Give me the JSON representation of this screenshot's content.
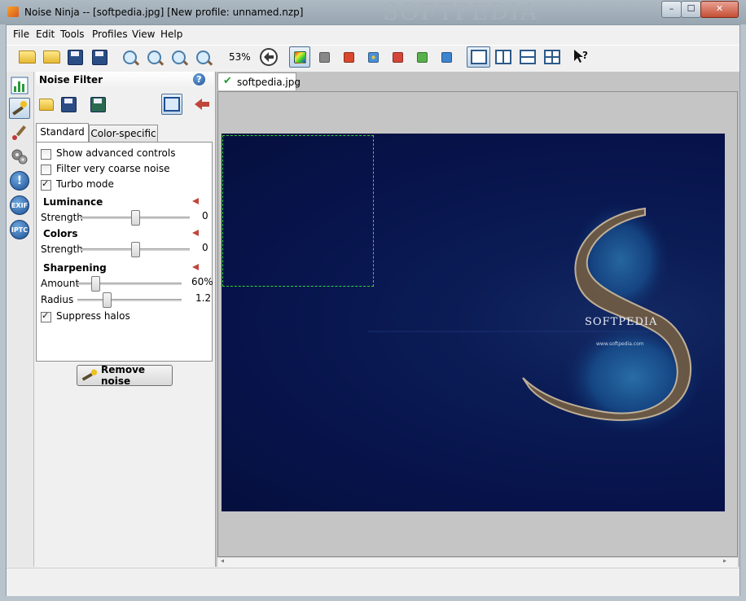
{
  "window": {
    "title": "Noise Ninja -- [softpedia.jpg] [New profile: unnamed.nzp]",
    "watermark": "SOFTPEDIA",
    "minimize": "–",
    "maximize": "☐",
    "close": "✕"
  },
  "menu": [
    "File",
    "Edit",
    "Tools",
    "Profiles",
    "View",
    "Help"
  ],
  "toolbar": {
    "zoom_label": "53%",
    "channel_colors": [
      "#888888",
      "#d9482c",
      "#4a8fd8",
      "#d4463a",
      "#58b04a",
      "#3d84d0"
    ],
    "icons": [
      "open-folder-icon",
      "open-profile-folder-icon",
      "save-icon",
      "save-as-icon",
      "zoom-in-icon",
      "zoom-out-icon",
      "zoom-fit-icon",
      "zoom-actual-icon",
      "back-icon",
      "color-channels-icon",
      "single-view-icon",
      "split-vertical-icon",
      "split-horizontal-icon",
      "quad-view-icon",
      "help-pointer-icon"
    ]
  },
  "sidebar_icons": [
    "histogram-icon",
    "noise-filter-wand-icon",
    "brush-icon",
    "gears-icon",
    "warning-icon",
    "exif-icon",
    "iptc-icon"
  ],
  "sidebar_labels": {
    "exif": "EXIF",
    "iptc": "IPTC"
  },
  "panel": {
    "title": "Noise Filter",
    "help": "?",
    "tabs": [
      "Standard",
      "Color-specific"
    ],
    "options": [
      {
        "label": "Show advanced controls",
        "checked": false
      },
      {
        "label": "Filter very coarse noise",
        "checked": false
      },
      {
        "label": "Turbo mode",
        "checked": true
      }
    ],
    "luminance": {
      "title": "Luminance",
      "strength_label": "Strength",
      "strength_value": "0",
      "strength": 0.5
    },
    "colors": {
      "title": "Colors",
      "strength_label": "Strength",
      "strength_value": "0",
      "strength": 0.5
    },
    "sharpening": {
      "title": "Sharpening",
      "amount_label": "Amount",
      "amount_value": "60%",
      "amount": 0.17,
      "radius_label": "Radius",
      "radius_value": "1.2",
      "radius": 0.28,
      "suppress_label": "Suppress halos",
      "suppress_checked": true
    },
    "remove_button": "Remove noise"
  },
  "document": {
    "tab_label": "softpedia.jpg",
    "image_text": "SOFTPEDIA",
    "image_url_text": "www.softpedia.com"
  }
}
